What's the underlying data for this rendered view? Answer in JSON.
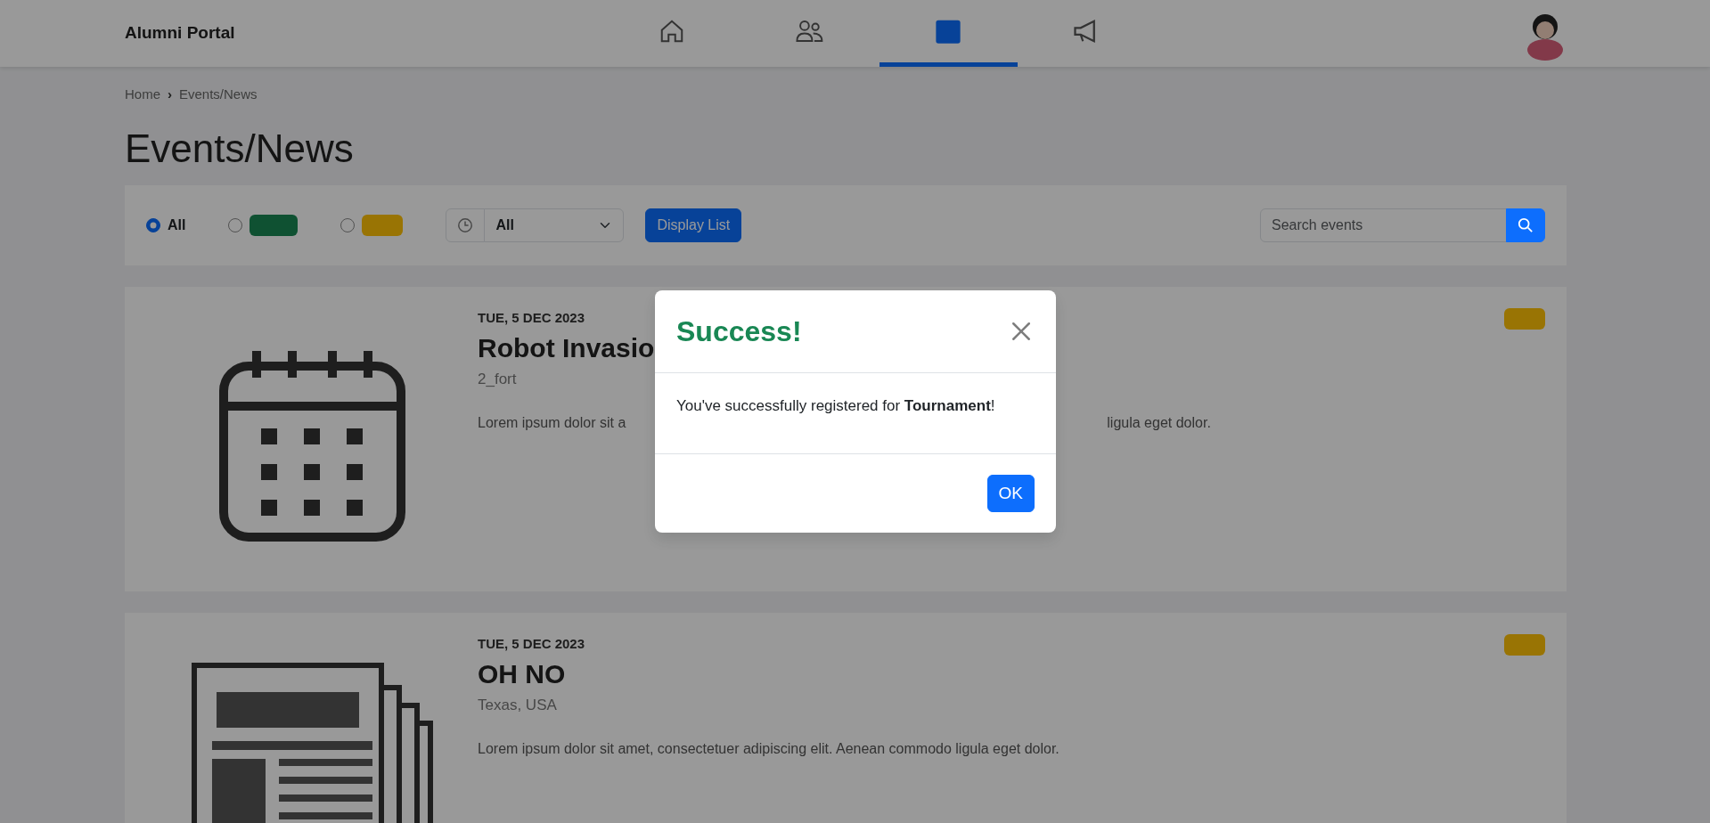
{
  "navbar": {
    "brand": "Alumni Portal",
    "nav_items": [
      {
        "kind": "home",
        "selected": false
      },
      {
        "kind": "people",
        "selected": false
      },
      {
        "kind": "calendar",
        "selected": true
      },
      {
        "kind": "megaphone",
        "selected": false
      }
    ]
  },
  "breadcrumb": {
    "items": [
      "Home",
      "Events/News"
    ],
    "separator": "›"
  },
  "page_title": "Events/News",
  "filters": {
    "options": [
      {
        "label": "All",
        "kind": "plain",
        "selected": true
      },
      {
        "kind": "events",
        "selected": false
      },
      {
        "kind": "news",
        "selected": false
      }
    ],
    "time_select": "All",
    "display_button": "Display List",
    "search": {
      "placeholder": "Search events"
    }
  },
  "events": [
    {
      "kind": "calendar",
      "date": "TUE, 5 DEC 2023",
      "title": "Robot Invasio",
      "location": "2_fort",
      "description": "Lorem ipsum dolor sit a",
      "description_end": "ligula eget dolor.",
      "tag": {
        "kind": "news"
      }
    },
    {
      "kind": "news",
      "date": "TUE, 5 DEC 2023",
      "title": "OH NO",
      "location": "Texas, USA",
      "description": "Lorem ipsum dolor sit amet, consectetuer adipiscing elit. Aenean commodo ligula eget dolor.",
      "tag": {
        "kind": "news"
      }
    }
  ],
  "modal": {
    "title": "Success!",
    "message": "You've successfully registered for **Tournament**!",
    "ok_button": "OK"
  }
}
